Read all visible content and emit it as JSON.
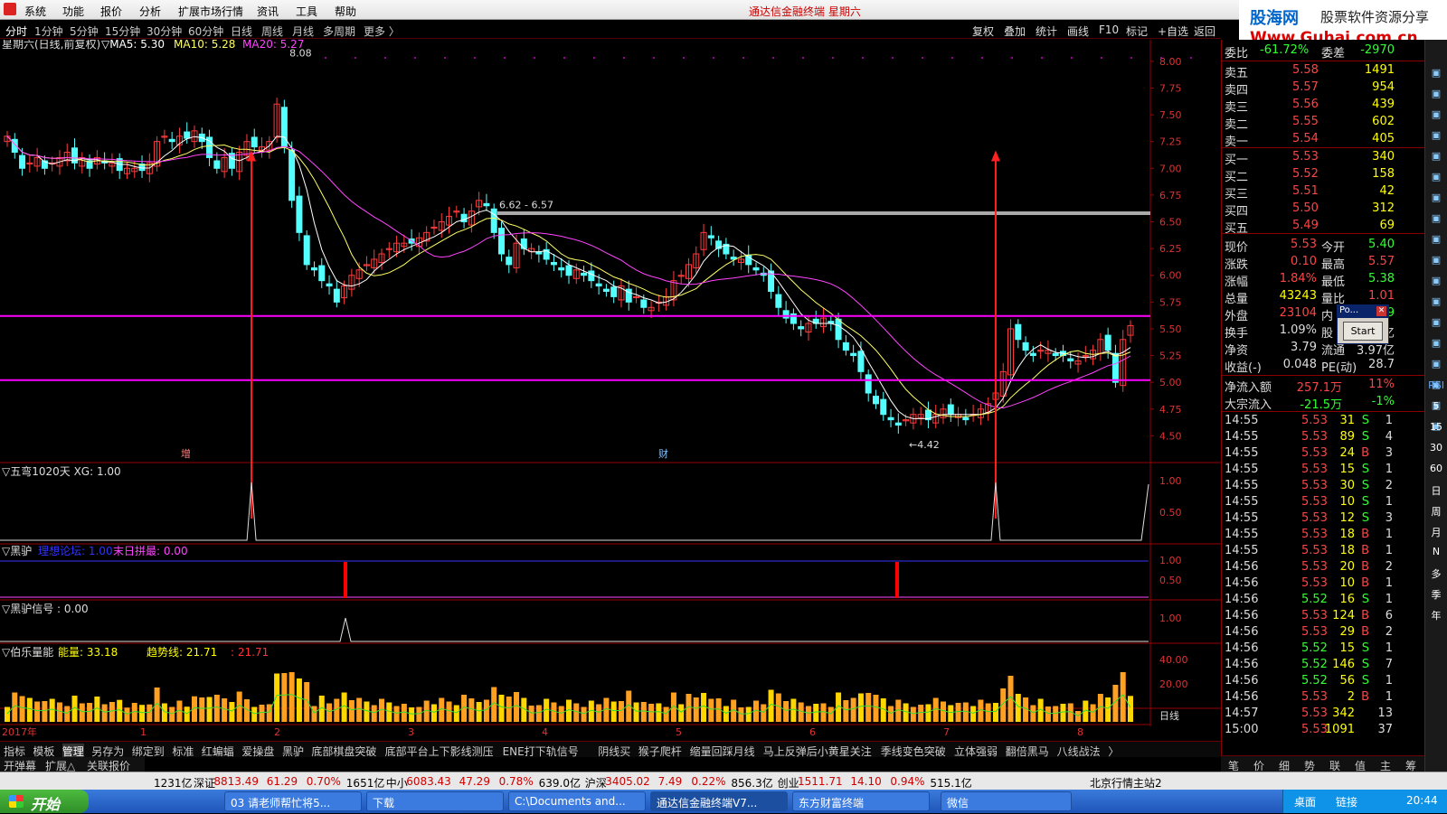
{
  "menu": {
    "items": [
      "系统",
      "功能",
      "报价",
      "分析",
      "扩展市场行情",
      "资讯",
      "工具",
      "帮助"
    ],
    "app_title": "通达信金融终端 星期六"
  },
  "banner": {
    "site": "股海网",
    "slogan": "股票软件资源分享",
    "url": "Www.Guhai.com.cn"
  },
  "toolbar": {
    "periods": [
      "分时",
      "1分钟",
      "5分钟",
      "15分钟",
      "30分钟",
      "60分钟",
      "日线",
      "周线",
      "月线",
      "多周期",
      "更多 〉"
    ],
    "active": "分时",
    "right": [
      "复权",
      "叠加",
      "统计",
      "画线",
      "F10",
      "标记",
      "+自选",
      "返回"
    ]
  },
  "main_header": {
    "name": "星期六(日线,前复权)",
    "ma5": "▽MA5: 5.30",
    "ma10": "MA10: 5.28",
    "ma20": "MA20: 5.27"
  },
  "chart_data": {
    "type": "candlestick",
    "ylim": [
      4.25,
      8.1
    ],
    "yticks": [
      "8.00",
      "7.75",
      "7.50",
      "7.25",
      "7.00",
      "6.75",
      "6.50",
      "6.25",
      "6.00",
      "5.75",
      "5.50",
      "5.25",
      "5.00",
      "4.75",
      "4.50"
    ],
    "x_labels": [
      "2017年",
      "1",
      "2",
      "3",
      "4",
      "5",
      "6",
      "7",
      "8"
    ],
    "annotations": {
      "high": "8.08",
      "low": "←4.42",
      "range": "6.62 - 6.57",
      "mark_zeng": "增",
      "mark_cai": "财"
    },
    "hlines": [
      5.62,
      5.02,
      6.58
    ],
    "closes": [
      7.3,
      7.15,
      7.0,
      7.05,
      7.1,
      7.0,
      7.05,
      7.1,
      7.15,
      7.05,
      7.1,
      7.0,
      7.1,
      7.05,
      7.05,
      6.98,
      7.0,
      7.0,
      6.98,
      7.05,
      7.25,
      7.3,
      7.25,
      7.3,
      7.28,
      7.35,
      7.25,
      7.1,
      7.0,
      7.1,
      7.0,
      7.15,
      7.25,
      7.2,
      7.2,
      7.25,
      7.6,
      7.2,
      6.7,
      6.4,
      6.1,
      6.05,
      5.95,
      5.9,
      5.75,
      5.9,
      6.0,
      6.05,
      6.1,
      6.15,
      6.2,
      6.25,
      6.3,
      6.3,
      6.3,
      6.35,
      6.4,
      6.45,
      6.5,
      6.55,
      6.6,
      6.5,
      6.6,
      6.7,
      6.65,
      6.4,
      6.2,
      6.1,
      6.3,
      6.25,
      6.25,
      6.2,
      6.15,
      6.1,
      6.05,
      6.0,
      6.05,
      6.0,
      5.95,
      5.9,
      5.85,
      5.8,
      5.9,
      5.75,
      5.8,
      5.7,
      5.7,
      5.75,
      5.8,
      5.95,
      6.0,
      6.1,
      6.2,
      6.4,
      6.35,
      6.25,
      6.2,
      6.15,
      6.15,
      6.1,
      6.05,
      6.0,
      5.85,
      5.7,
      5.6,
      5.55,
      5.5,
      5.55,
      5.55,
      5.6,
      5.55,
      5.4,
      5.3,
      5.25,
      5.1,
      4.9,
      4.8,
      4.7,
      4.65,
      4.6,
      4.65,
      4.7,
      4.7,
      4.65,
      4.7,
      4.75,
      4.7,
      4.7,
      4.65,
      4.7,
      4.75,
      4.8,
      4.9,
      5.1,
      5.5,
      5.4,
      5.3,
      5.25,
      5.3,
      5.3,
      5.25,
      5.25,
      5.2,
      5.2,
      5.25,
      5.3,
      5.4,
      5.3,
      5.0,
      5.4,
      5.53
    ]
  },
  "ind1": {
    "name": "▽五弯1020天 XG: 1.00",
    "yticks": [
      "1.00",
      "0.50"
    ]
  },
  "ind2": {
    "name": "▽黑驴",
    "a": "理想论坛: 1.00",
    "b": "末日拼最: 0.00",
    "yticks": [
      "1.00",
      "0.50"
    ]
  },
  "ind3": {
    "name": "▽黑驴信号 : 0.00",
    "yticks": [
      "1.00"
    ]
  },
  "ind4": {
    "name": "▽伯乐量能",
    "a": "能量: 33.18",
    "b": "趋势线: 21.71",
    "c": ": 21.71",
    "yticks": [
      "40.00",
      "20.00"
    ],
    "period": "日线"
  },
  "quote": {
    "weibi": {
      "label": "委比",
      "value": "-61.72%",
      "label2": "委差",
      "value2": "-2970"
    },
    "sell": [
      {
        "l": "卖五",
        "p": "5.58",
        "v": "1491"
      },
      {
        "l": "卖四",
        "p": "5.57",
        "v": "954"
      },
      {
        "l": "卖三",
        "p": "5.56",
        "v": "439"
      },
      {
        "l": "卖二",
        "p": "5.55",
        "v": "602"
      },
      {
        "l": "卖一",
        "p": "5.54",
        "v": "405"
      }
    ],
    "buy": [
      {
        "l": "买一",
        "p": "5.53",
        "v": "340"
      },
      {
        "l": "买二",
        "p": "5.52",
        "v": "158"
      },
      {
        "l": "买三",
        "p": "5.51",
        "v": "42"
      },
      {
        "l": "买四",
        "p": "5.50",
        "v": "312"
      },
      {
        "l": "买五",
        "p": "5.49",
        "v": "69"
      }
    ],
    "stats": [
      {
        "l": "现价",
        "v": "5.53",
        "l2": "今开",
        "v2": "5.40"
      },
      {
        "l": "涨跌",
        "v": "0.10",
        "l2": "最高",
        "v2": "5.57"
      },
      {
        "l": "涨幅",
        "v": "1.84%",
        "l2": "最低",
        "v2": "5.38"
      },
      {
        "l": "总量",
        "v": "43243",
        "l2": "量比",
        "v2": "1.01"
      },
      {
        "l": "外盘",
        "v": "23104",
        "l2": "内",
        "v2": "20139"
      },
      {
        "l": "换手",
        "v": "1.09%",
        "l2": "股",
        "v2": "4.99亿"
      },
      {
        "l": "净资",
        "v": "3.79",
        "l2": "流通",
        "v2": "3.97亿"
      },
      {
        "l": "收益(-)",
        "v": "0.048",
        "l2": "PE(动)",
        "v2": "28.7"
      }
    ],
    "flow": [
      {
        "l": "净流入额",
        "v": "257.1万",
        "p": "11%"
      },
      {
        "l": "大宗流入",
        "v": "-21.5万",
        "p": "-1%"
      }
    ],
    "ticks": [
      [
        "14:55",
        "5.53",
        "31",
        "S",
        "1"
      ],
      [
        "14:55",
        "5.53",
        "89",
        "S",
        "4"
      ],
      [
        "14:55",
        "5.53",
        "24",
        "B",
        "3"
      ],
      [
        "14:55",
        "5.53",
        "15",
        "S",
        "1"
      ],
      [
        "14:55",
        "5.53",
        "30",
        "S",
        "2"
      ],
      [
        "14:55",
        "5.53",
        "10",
        "S",
        "1"
      ],
      [
        "14:55",
        "5.53",
        "12",
        "S",
        "3"
      ],
      [
        "14:55",
        "5.53",
        "18",
        "B",
        "1"
      ],
      [
        "14:55",
        "5.53",
        "18",
        "B",
        "1"
      ],
      [
        "14:56",
        "5.53",
        "20",
        "B",
        "2"
      ],
      [
        "14:56",
        "5.53",
        "10",
        "B",
        "1"
      ],
      [
        "14:56",
        "5.52",
        "16",
        "S",
        "1"
      ],
      [
        "14:56",
        "5.53",
        "124",
        "B",
        "6"
      ],
      [
        "14:56",
        "5.53",
        "29",
        "B",
        "2"
      ],
      [
        "14:56",
        "5.52",
        "15",
        "S",
        "1"
      ],
      [
        "14:56",
        "5.52",
        "146",
        "S",
        "7"
      ],
      [
        "14:56",
        "5.52",
        "56",
        "S",
        "1"
      ],
      [
        "14:56",
        "5.53",
        "2",
        "B",
        "1"
      ],
      [
        "14:57",
        "5.53",
        "342",
        "",
        "13"
      ],
      [
        "15:00",
        "5.53",
        "1091",
        "",
        "37"
      ]
    ]
  },
  "popup": {
    "title": "Po...",
    "button": "Start"
  },
  "formula_tabs": [
    "指标",
    "模板",
    "管理",
    "另存为",
    "绑定到",
    "标准",
    "红蝙蝠",
    "爱操盘",
    "黑驴",
    "底部棋盘突破",
    "底部平台上下影线测压",
    "ENE打下轨信号",
    "阴线买",
    "猴子爬杆",
    "缩量回踩月线",
    "马上反弹后小黄星关注",
    "季线变色突破",
    "立体强弱",
    "翻倍黑马",
    "八线战法",
    "〉"
  ],
  "ext_tabs": [
    "开弹幕",
    "扩展△",
    "关联报价"
  ],
  "panel_tabs": [
    "笔",
    "价",
    "细",
    "势",
    "联",
    "值",
    "主",
    "筹"
  ],
  "sidebar_labels": [
    "RSI",
    "5",
    "15",
    "30",
    "60",
    "日",
    "周",
    "月",
    "N",
    "多",
    "季",
    "年"
  ],
  "status": {
    "items": [
      "1231亿",
      "深证",
      "8813.49",
      "61.29",
      "0.70%",
      "1651亿",
      "中小",
      "6083.43",
      "47.29",
      "0.78%",
      "639.0亿",
      "沪深",
      "3405.02",
      "7.49",
      "0.22%",
      "856.3亿",
      "创业",
      "1511.71",
      "14.10",
      "0.94%",
      "515.1亿"
    ],
    "server": "北京行情主站2"
  },
  "taskbar": {
    "start": "开始",
    "tasks": [
      "03 请老师帮忙将5...",
      "下载",
      "C:\\Documents and...",
      "通达信金融终端V7...",
      "东方财富终端",
      "微信"
    ],
    "tray": [
      "桌面",
      "链接"
    ],
    "time": "20:44"
  }
}
